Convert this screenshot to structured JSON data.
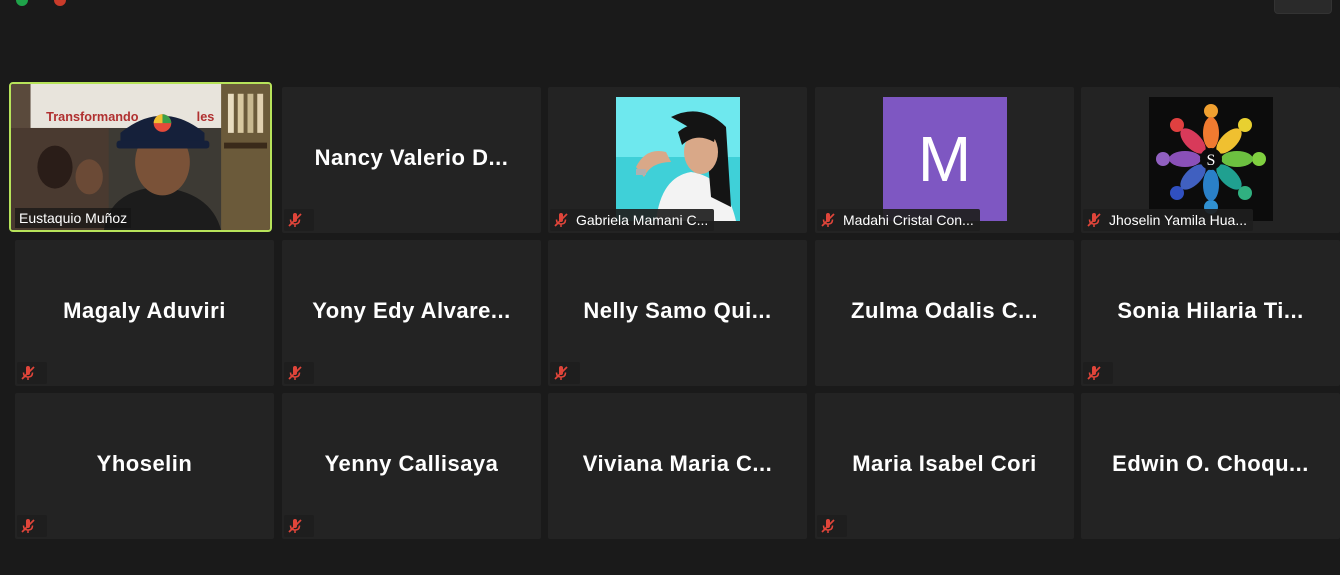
{
  "window": {
    "indicators": [
      "green",
      "red"
    ]
  },
  "participants": [
    {
      "name": "Eustaquio Muñoz",
      "type": "video",
      "muted": false,
      "active": true,
      "banner_text": "Transformando"
    },
    {
      "name": "Nancy  Valerio  D...",
      "type": "name",
      "muted": true
    },
    {
      "name": "Gabriela Mamani C...",
      "type": "photo",
      "muted": true
    },
    {
      "name": "Madahi Cristal Con...",
      "type": "letter-avatar",
      "muted": true,
      "avatar_letter": "M",
      "avatar_color": "#7e57c2"
    },
    {
      "name": "Jhoselin Yamila Hua...",
      "type": "logo-avatar",
      "muted": true,
      "logo_letter": "S"
    },
    {
      "name": "Magaly Aduviri",
      "type": "name",
      "muted": true
    },
    {
      "name": "Yony  Edy  Alvare...",
      "type": "name",
      "muted": true
    },
    {
      "name": "Nelly  Samo  Qui...",
      "type": "name",
      "muted": true
    },
    {
      "name": "Zulma  Odalis  C...",
      "type": "name",
      "muted": false
    },
    {
      "name": "Sonia  Hilaria   Ti...",
      "type": "name",
      "muted": true
    },
    {
      "name": "Yhoselin",
      "type": "name",
      "muted": true
    },
    {
      "name": "Yenny Callisaya",
      "type": "name",
      "muted": true
    },
    {
      "name": "Viviana  Maria  C...",
      "type": "name",
      "muted": false
    },
    {
      "name": "Maria Isabel Cori",
      "type": "name",
      "muted": true
    },
    {
      "name": "Edwin  O.  Choqu...",
      "type": "name",
      "muted": false
    }
  ],
  "colors": {
    "background": "#1a1a1a",
    "tile": "#232323",
    "active_speaker": "#b7e35a",
    "mute_red": "#e0453a"
  }
}
